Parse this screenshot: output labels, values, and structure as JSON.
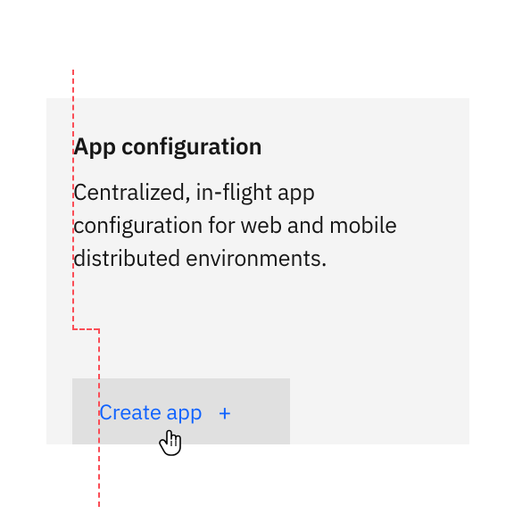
{
  "card": {
    "title": "App configuration",
    "description": "Centralized, in-flight app configuration for web and mobile distributed environments."
  },
  "button": {
    "label": "Create app",
    "icon": "+"
  }
}
